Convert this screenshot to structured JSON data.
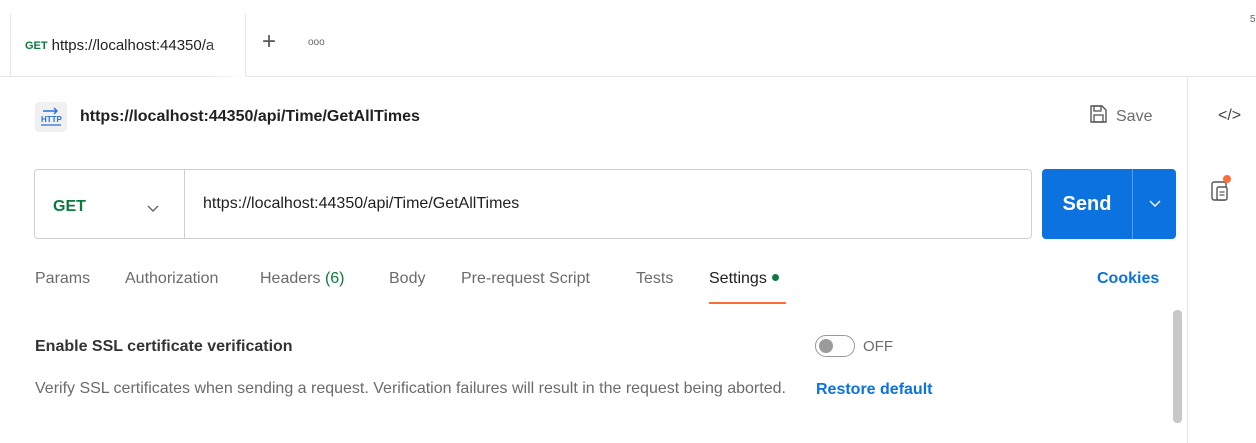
{
  "tab": {
    "method": "GET",
    "url": "https://localhost:44350/a"
  },
  "tab_bar": {
    "plus": "+",
    "more": "ooo",
    "edge_char": "5"
  },
  "request": {
    "title": "https://localhost:44350/api/Time/GetAllTimes",
    "method": "GET",
    "url": "https://localhost:44350/api/Time/GetAllTimes"
  },
  "toolbar": {
    "save_label": "Save",
    "send_label": "Send"
  },
  "right_rail": {
    "code_glyph": "</>"
  },
  "subtabs": {
    "params": "Params",
    "authorization": "Authorization",
    "headers": "Headers",
    "headers_count": "(6)",
    "body": "Body",
    "prerequest": "Pre-request Script",
    "tests": "Tests",
    "settings": "Settings",
    "cookies": "Cookies"
  },
  "settings": {
    "ssl_title": "Enable SSL certificate verification",
    "ssl_description": "Verify SSL certificates when sending a request. Verification failures will result in the request being aborted.",
    "toggle_state": "OFF",
    "restore_label": "Restore default"
  },
  "colors": {
    "accent": "#0b72df",
    "method_get": "#0b7a3e",
    "active_underline": "#ff6c37",
    "notification": "#ff6c37"
  }
}
